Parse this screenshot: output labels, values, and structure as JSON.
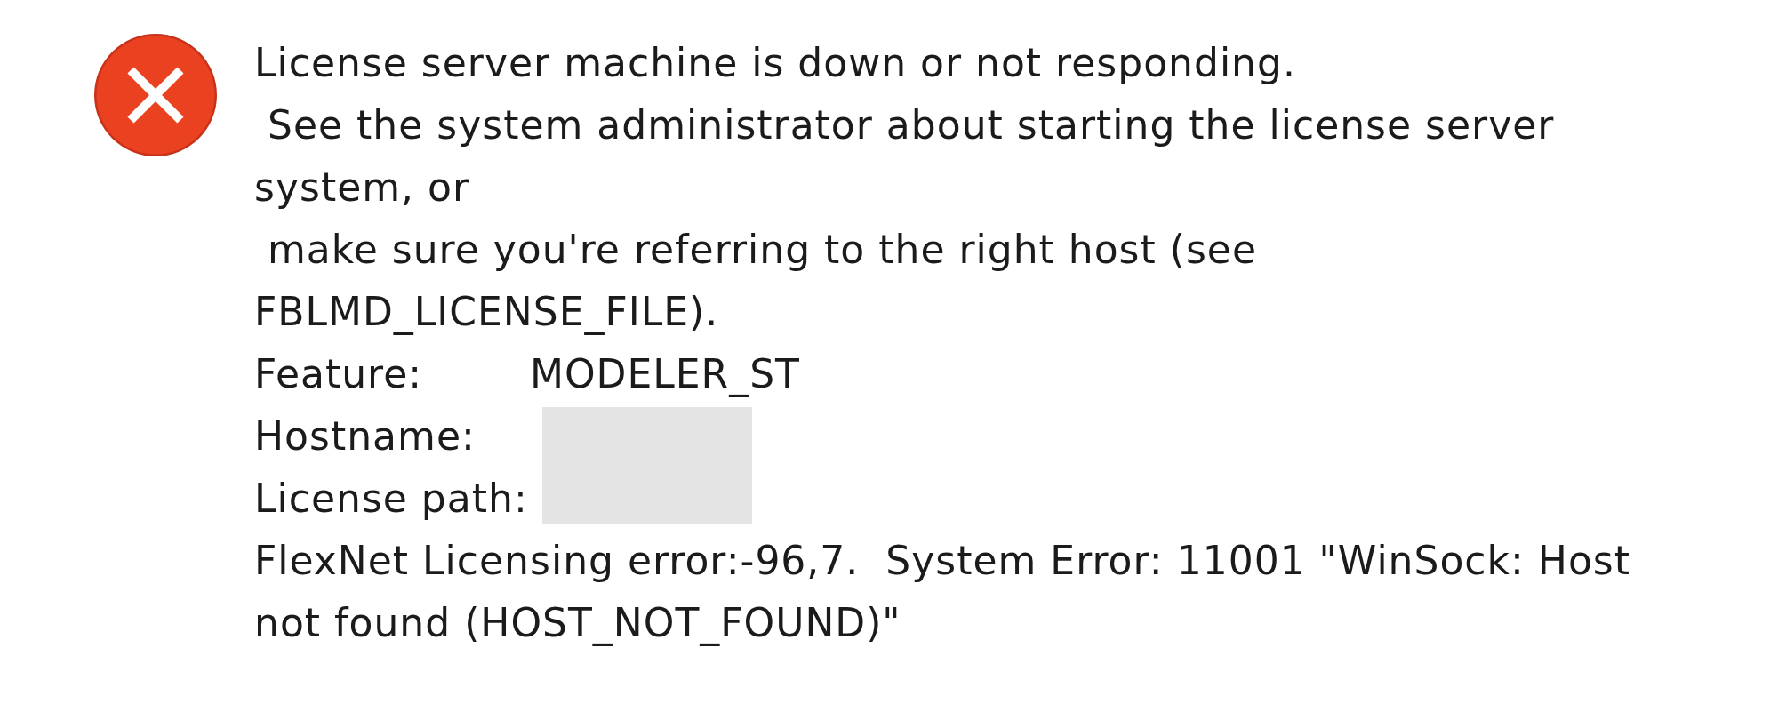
{
  "dialog": {
    "icon": {
      "kind": "error"
    },
    "message_lines": [
      "License server machine is down or not responding.",
      " See the system administrator about starting the license server",
      "system, or",
      " make sure you're referring to the right host (see",
      "FBLMD_LICENSE_FILE)."
    ],
    "fields": [
      {
        "label": "Feature:",
        "value": "MODELER_ST",
        "redacted": false
      },
      {
        "label": "Hostname:",
        "redacted": true
      },
      {
        "label": "License path:",
        "redacted": true
      }
    ],
    "error_lines": [
      "FlexNet Licensing error:-96,7.  System Error: 11001 \"WinSock: Host",
      "not found (HOST_NOT_FOUND)\""
    ]
  }
}
